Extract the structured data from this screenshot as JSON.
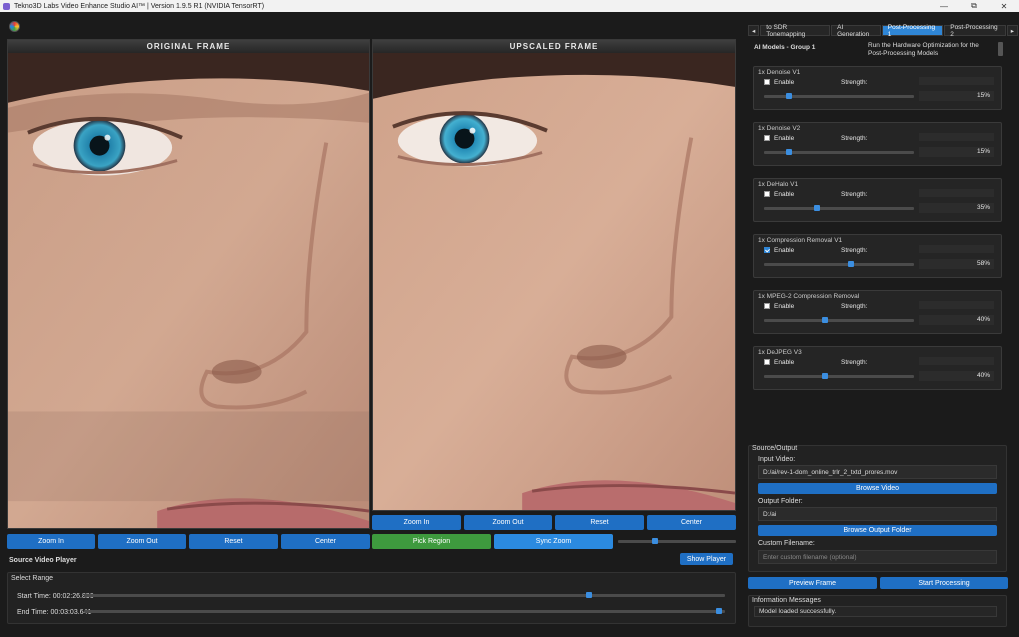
{
  "window": {
    "title": "Tekno3D Labs Video Enhance Studio AI™ | Version 1.9.5 R1 (NVIDIA TensorRT)",
    "minimize": "—",
    "maximize": "⧉",
    "close": "✕"
  },
  "panels": {
    "original": "ORIGINAL FRAME",
    "upscaled": "UPSCALED FRAME"
  },
  "left_controls": {
    "zoom_in": "Zoom In",
    "zoom_out": "Zoom Out",
    "reset": "Reset",
    "center": "Center"
  },
  "right_controls": {
    "zoom_in": "Zoom In",
    "zoom_out": "Zoom Out",
    "reset": "Reset",
    "center": "Center",
    "pick_region": "Pick Region",
    "sync_zoom": "Sync Zoom",
    "zoom_level": 0.3
  },
  "source_player": {
    "label": "Source Video Player",
    "show_player": "Show Player"
  },
  "range": {
    "title": "Select Range",
    "start_label": "Start Time: 00:02:26.896",
    "end_label": "End Time: 00:03:03.641",
    "start_pos": 0.79,
    "end_pos": 0.995
  },
  "tabs": {
    "prev": "◂",
    "next": "▸",
    "items": [
      "to SDR Tonemapping",
      "AI Generation",
      "Post-Processing 1",
      "Post-Processing 2"
    ],
    "active": "Post-Processing 1"
  },
  "ai_models": {
    "group_title": "AI Models - Group 1",
    "hint": "Run the Hardware Optimization for the Post-Processing Models",
    "enable_label": "Enable",
    "strength_label": "Strength:",
    "models": [
      {
        "name": "1x Denoise V1",
        "enabled": false,
        "strength": "15%",
        "value": 0.15
      },
      {
        "name": "1x Denoise V2",
        "enabled": false,
        "strength": "15%",
        "value": 0.15
      },
      {
        "name": "1x DeHalo V1",
        "enabled": false,
        "strength": "35%",
        "value": 0.35
      },
      {
        "name": "1x Compression Removal V1",
        "enabled": true,
        "strength": "58%",
        "value": 0.58
      },
      {
        "name": "1x MPEG-2 Compression Removal",
        "enabled": false,
        "strength": "40%",
        "value": 0.4
      },
      {
        "name": "1x DeJPEG V3",
        "enabled": false,
        "strength": "40%",
        "value": 0.4
      }
    ]
  },
  "source_output": {
    "title": "Source/Output",
    "input_label": "Input Video:",
    "input_value": "D:/ai/rev-1-dom_online_trlr_2_txtd_prores.mov",
    "browse_video": "Browse Video",
    "output_label": "Output Folder:",
    "output_value": "D:/ai",
    "browse_output": "Browse Output Folder",
    "custom_label": "Custom Filename:",
    "custom_placeholder": "Enter custom filename (optional)"
  },
  "actions": {
    "preview": "Preview Frame",
    "start": "Start Processing"
  },
  "info": {
    "title": "Information Messages",
    "message": "Model loaded successfully."
  },
  "colors": {
    "accent": "#1f6fc4",
    "green": "#3e9a3e",
    "bg": "#1b1b1b"
  }
}
